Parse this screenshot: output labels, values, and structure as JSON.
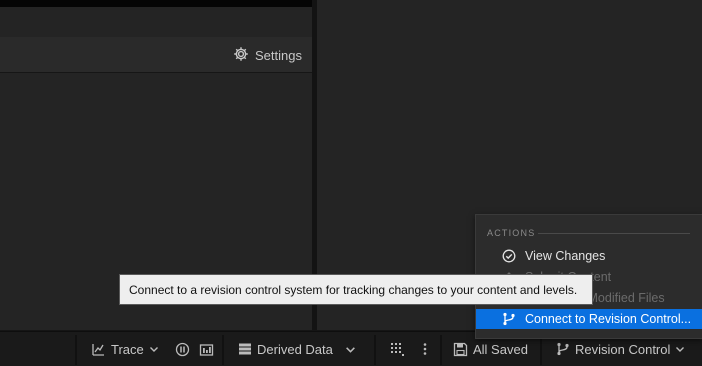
{
  "panel": {
    "settings_label": "Settings"
  },
  "statusbar": {
    "trace_label": "Trace",
    "derived_data_label": "Derived Data",
    "all_saved_label": "All Saved",
    "revision_control_label": "Revision Control"
  },
  "menu": {
    "section_title": "ACTIONS",
    "items": [
      {
        "label": "View Changes",
        "icon": "check-circle-icon",
        "state": "enabled"
      },
      {
        "label": "Submit Content",
        "icon": "submit-icon",
        "state": "disabled"
      },
      {
        "label": "Check Out Modified Files",
        "icon": "checkout-icon",
        "state": "disabled"
      },
      {
        "label": "Connect to Revision Control...",
        "icon": "branch-icon",
        "state": "highlighted"
      }
    ]
  },
  "tooltip": {
    "text": "Connect to a revision control system for tracking changes to your content and levels."
  },
  "colors": {
    "accent": "#0a70e0",
    "panel": "#242424",
    "statusbar": "#1a1a1a",
    "tooltip_bg": "#eeeeee"
  }
}
